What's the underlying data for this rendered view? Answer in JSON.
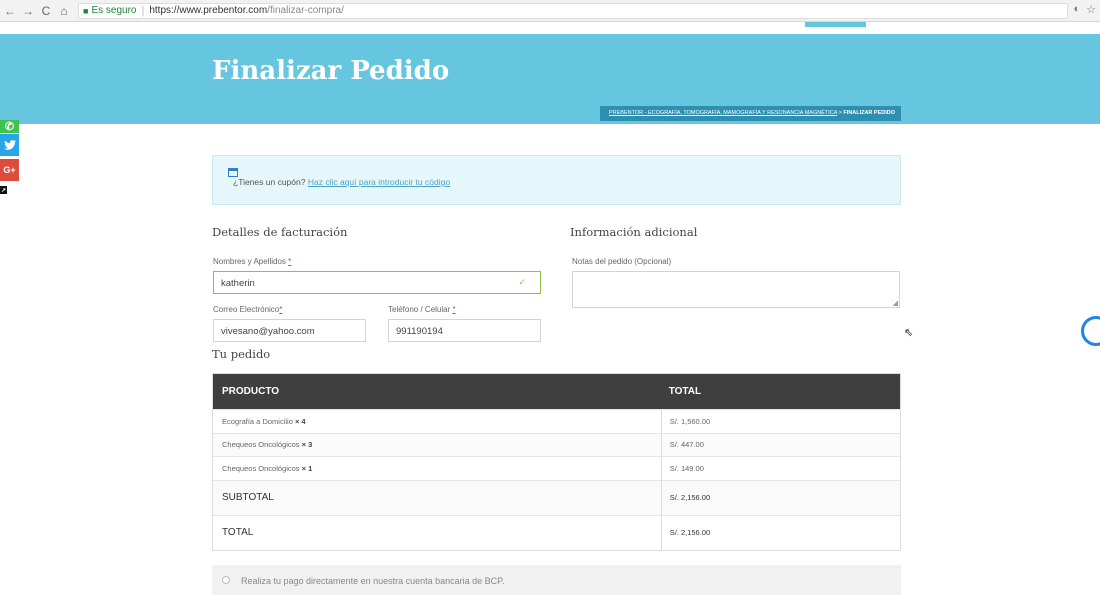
{
  "browser": {
    "back": "←",
    "forward": "→",
    "reload": "C",
    "home": "⌂",
    "secure_label": "Es seguro",
    "url_host": "https://www.prebentor.com",
    "url_path": "/finalizar-compra/",
    "ext_icon": "◐",
    "star_icon": "☆"
  },
  "page": {
    "title": "Finalizar Pedido",
    "breadcrumb_link": "PREBENTOR - ECOGRAFÍA, TOMOGRAFÍA, MAMOGRAFÍA Y RESONANCIA MAGNÉTICA",
    "breadcrumb_sep": " > ",
    "breadcrumb_current": "FINALIZAR PEDIDO"
  },
  "social": {
    "twitter": "🐦",
    "gplus": "G+",
    "whatsapp": "✆",
    "share": "↗"
  },
  "coupon": {
    "question": "¿Tienes un cupón?",
    "link": "Haz clic aquí para introducir tu código"
  },
  "billing": {
    "title": "Detalles de facturación",
    "name_label": "Nombres y Apellidos",
    "name_value": "katherin",
    "email_label": "Correo Electrónico",
    "email_value": "vivesano@yahoo.com",
    "phone_label": "Teléfono / Celular",
    "phone_value": "991190194",
    "required": "*"
  },
  "additional": {
    "title": "Información adicional",
    "notes_label": "Notas del pedido (Opcional)"
  },
  "order": {
    "title": "Tu pedido",
    "col_product": "PRODUCTO",
    "col_total": "TOTAL",
    "items": [
      {
        "name": "Ecografía a Domicilio",
        "qty": "× 4",
        "total": "S/. 1,560.00"
      },
      {
        "name": "Chequeos Oncológicos",
        "qty": "× 3",
        "total": "S/. 447.00"
      },
      {
        "name": "Chequeos Oncológicos",
        "qty": "× 1",
        "total": "S/. 149.00"
      }
    ],
    "subtotal_label": "SUBTOTAL",
    "subtotal_value": "S/. 2,156.00",
    "total_label": "TOTAL",
    "total_value": "S/. 2,156.00"
  },
  "payment": {
    "bcp_text": "Realiza tu pago directamente en nuestra cuenta bancaria de BCP."
  }
}
